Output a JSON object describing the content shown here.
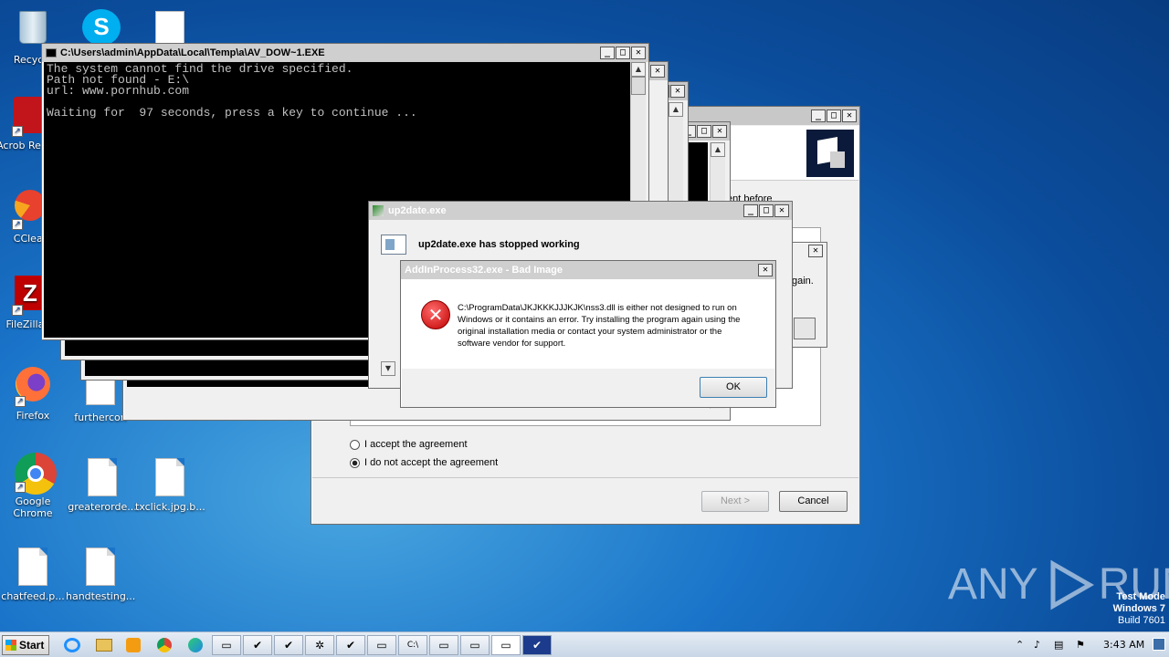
{
  "desktop": {
    "icons": [
      {
        "label": "Recycle"
      },
      {
        "label": "Acrob Reader"
      },
      {
        "label": "CClear"
      },
      {
        "label": "FileZilla C"
      },
      {
        "label": "Firefox"
      },
      {
        "label": "furthercon"
      },
      {
        "label": "Google Chrome"
      },
      {
        "label": "greaterorde..."
      },
      {
        "label": "txclick.jpg.b..."
      },
      {
        "label": "chatfeed.p..."
      },
      {
        "label": "handtesting..."
      }
    ],
    "watermark": {
      "brand": "ANY",
      "brand2": "RUN",
      "mode": "Test Mode",
      "os": "Windows 7",
      "build": "Build 7601"
    }
  },
  "console": {
    "title": "C:\\Users\\admin\\AppData\\Local\\Temp\\a\\AV_DOW~1.EXE",
    "lines": "The system cannot find the drive specified.\nPath not found - E:\\\nurl: www.pornhub.com\n\nWaiting for  97 seconds, press a key to continue ..."
  },
  "installer": {
    "text_before": "ent before",
    "text_again": "gain.",
    "radio_accept": "I accept the agreement",
    "radio_decline": "I do not accept the agreement",
    "next_label": "Next >",
    "cancel_label": "Cancel"
  },
  "up2date": {
    "title": "up2date.exe",
    "message": "up2date.exe has stopped working"
  },
  "bad_image": {
    "title": "AddInProcess32.exe - Bad Image",
    "message": "C:\\ProgramData\\JKJKKKJJJKJK\\nss3.dll is either not designed to run on Windows or it contains an error. Try installing the program again using the original installation media or contact your system administrator or the software vendor for support.",
    "ok_label": "OK"
  },
  "taskbar": {
    "start_label": "Start",
    "clock": "3:43 AM"
  }
}
